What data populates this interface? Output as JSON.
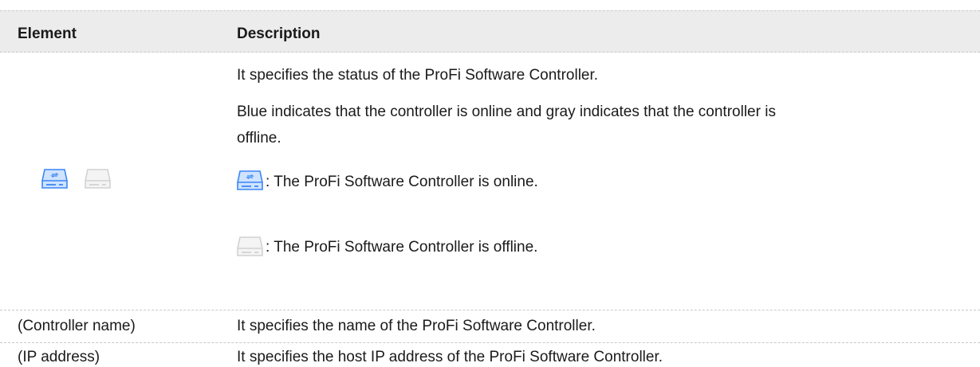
{
  "header": {
    "element": "Element",
    "description": "Description"
  },
  "status_row": {
    "line1": "It specifies the status of the ProFi Software Controller.",
    "line2": "Blue indicates that the controller is online and gray indicates that the controller is",
    "line3": "offline.",
    "online_label": ": The ProFi Software Controller is online.",
    "offline_label": ": The ProFi Software Controller is offline.",
    "icons": {
      "online": "controller-online-icon",
      "offline": "controller-offline-icon"
    },
    "colors": {
      "online_fill": "#cfe3ff",
      "online_stroke": "#3a86f5",
      "offline_fill": "#f4f4f4",
      "offline_stroke": "#d2d2d2"
    }
  },
  "name_row": {
    "element": "(Controller name)",
    "description": "It specifies the name of the ProFi Software Controller."
  },
  "ip_row": {
    "element": "(IP address)",
    "description": "It specifies the host IP address of the ProFi Software Controller."
  }
}
